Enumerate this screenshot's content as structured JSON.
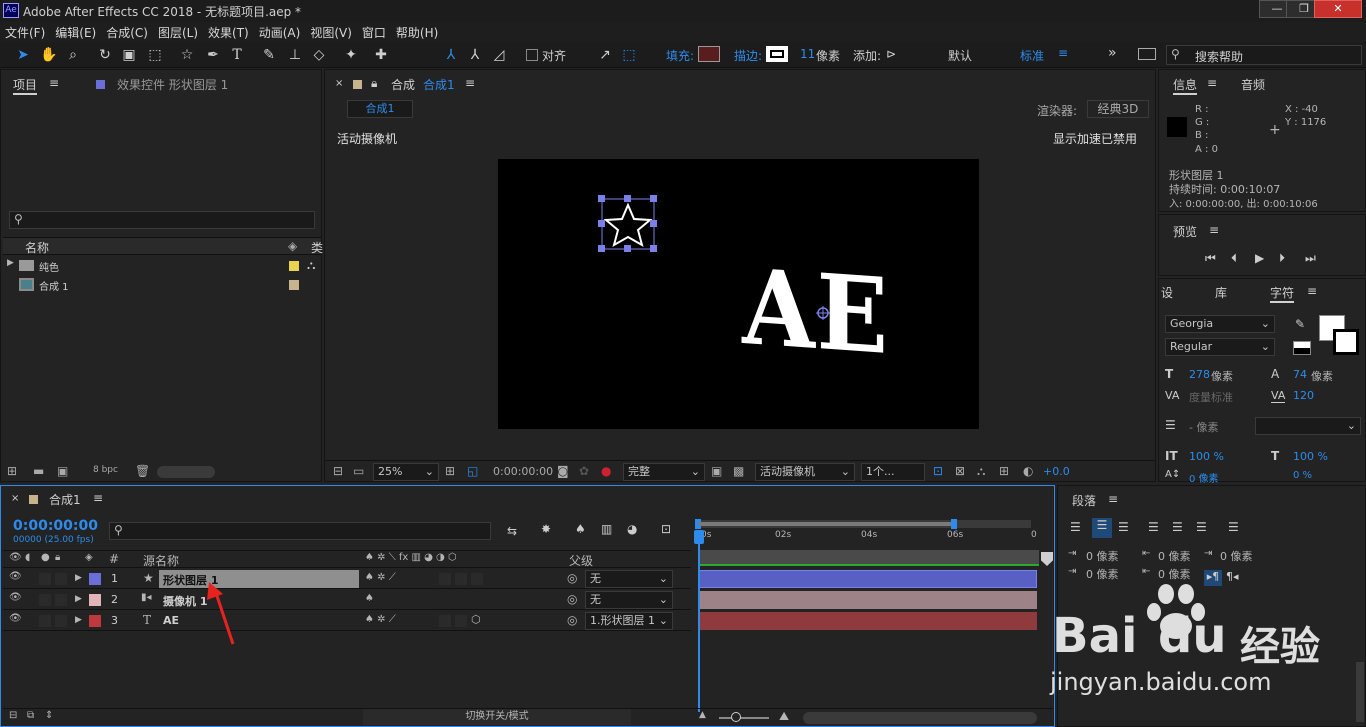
{
  "window": {
    "title": "Adobe After Effects CC 2018 - 无标题项目.aep *",
    "app_icon": "Ae",
    "minimize": "—",
    "restore": "❐",
    "close": "✕"
  },
  "menu": [
    "文件(F)",
    "编辑(E)",
    "合成(C)",
    "图层(L)",
    "效果(T)",
    "动画(A)",
    "视图(V)",
    "窗口",
    "帮助(H)"
  ],
  "toolbar": {
    "snap_label": "对齐",
    "fill_label": "填充:",
    "stroke_label": "描边:",
    "stroke_px": "11",
    "stroke_unit": "像素",
    "add_label": "添加:",
    "workspace_default": "默认",
    "workspace_standard": "标准",
    "more": "»",
    "search_placeholder": "搜索帮助"
  },
  "project_panel": {
    "tab_project": "项目",
    "tab_effects": "效果控件 形状图层 1",
    "col_name": "名称",
    "col_type": "类",
    "items": [
      {
        "name": "纯色",
        "kind": "folder",
        "label_color": "#e8d44d"
      },
      {
        "name": "合成 1",
        "kind": "comp",
        "label_color": "#c8b48c"
      }
    ],
    "bpc": "8 bpc"
  },
  "comp_panel": {
    "tab_label": "合成",
    "tab_name": "合成1",
    "sub_tab": "合成1",
    "renderer_label": "渲染器:",
    "renderer_value": "经典3D",
    "camera_label": "活动摄像机",
    "accel_label": "显示加速已禁用",
    "canvas_text": "AE",
    "zoom": "25%",
    "timecode": "0:00:00:00",
    "quality": "完整",
    "camera_select": "活动摄像机",
    "views": "1个...",
    "exposure": "+0.0"
  },
  "info_panel": {
    "tab_info": "信息",
    "tab_audio": "音频",
    "r": "R :",
    "g": "G :",
    "b": "B :",
    "a": "A : 0",
    "x": "X : -40",
    "y": "Y : 1176",
    "layer_name": "形状图层 1",
    "duration": "持续时间: 0:00:10:07",
    "in_out": "入: 0:00:00:00, 出: 0:00:10:06"
  },
  "preview_panel": {
    "title": "预览"
  },
  "char_panel": {
    "tab_settings": "设",
    "tab_library": "库",
    "tab_character": "字符",
    "font": "Georgia",
    "style": "Regular",
    "size": "278",
    "size_unit": "像素",
    "leading": "74",
    "leading_unit": "像素",
    "kerning": "度量标准",
    "tracking": "120",
    "stroke_width": "- 像素",
    "vscale": "100 %",
    "hscale": "100 %",
    "baseline": "0 像素",
    "tsume": "0 %"
  },
  "timeline": {
    "tab": "合成1",
    "timecode": "0:00:00:00",
    "fps": "00000 (25.00 fps)",
    "col_source": "源名称",
    "col_parent": "父级",
    "ruler": [
      "0s",
      "02s",
      "04s",
      "06s",
      "0"
    ],
    "layers": [
      {
        "num": "1",
        "name": "形状图层 1",
        "icon": "★",
        "color": "#6a6fd8",
        "parent": "无",
        "bar": "#5960c4"
      },
      {
        "num": "2",
        "name": "摄像机 1",
        "icon": "▮◂",
        "color": "#e2b3b9",
        "parent": "无",
        "bar": "#9d8388"
      },
      {
        "num": "3",
        "name": "AE",
        "icon": "T",
        "color": "#c0383e",
        "parent": "1.形状图层 1",
        "bar": "#8f3a3d"
      }
    ],
    "footer": "切换开关/模式"
  },
  "para_panel": {
    "title": "段落",
    "indent_left": "0 像素",
    "indent_right": "0 像素",
    "indent_first": "0 像素",
    "space_before": "0 像素",
    "space_after": "0 像素"
  },
  "watermark": {
    "brand": "Bai",
    "brand2": "du",
    "cn": "经验",
    "url": "jingyan.baidu.com"
  }
}
